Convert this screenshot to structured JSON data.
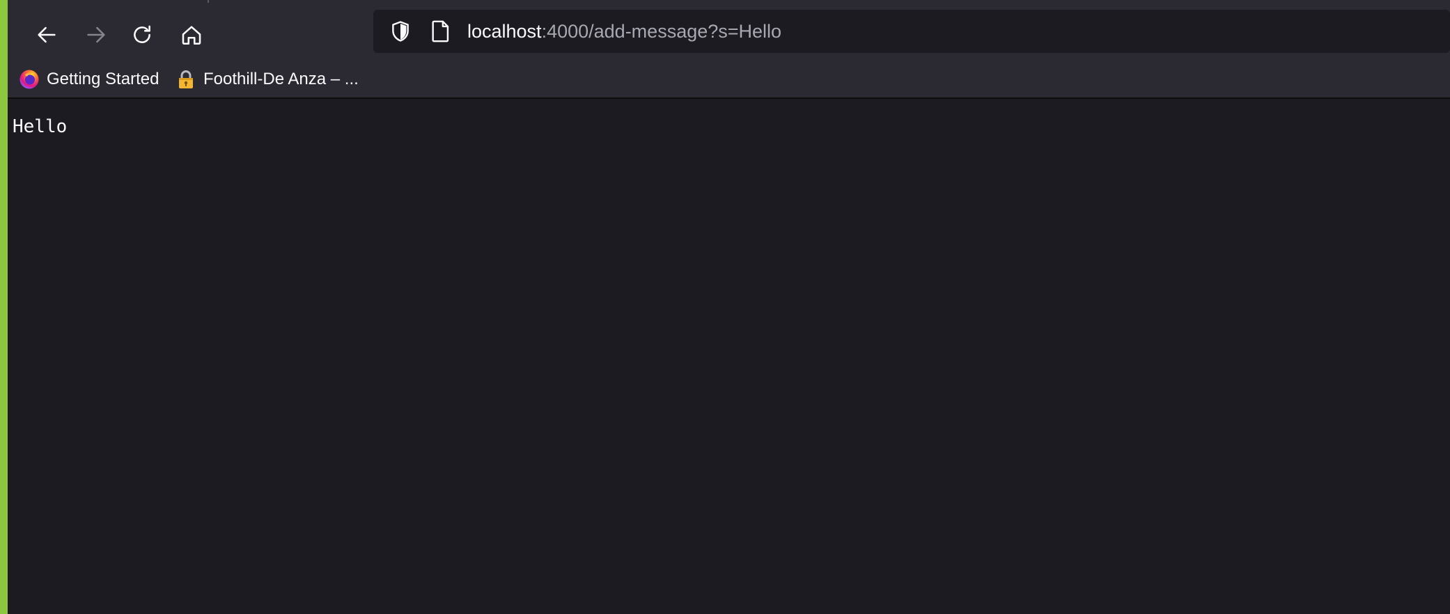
{
  "toolbar": {
    "back_icon": "back-arrow-icon",
    "forward_icon": "forward-arrow-icon",
    "reload_icon": "reload-icon",
    "home_icon": "home-icon"
  },
  "urlbar": {
    "host": "localhost",
    "rest": ":4000/add-message?s=Hello",
    "shield_icon": "tracking-protection-shield-icon",
    "page_icon": "page-icon"
  },
  "bookmarks": [
    {
      "label": "Getting Started",
      "icon": "firefox-logo-icon"
    },
    {
      "label": "Foothill-De Anza – ...",
      "icon": "lock-icon"
    }
  ],
  "page": {
    "text": "Hello"
  },
  "colors": {
    "accent_left_edge": "#8dc63f",
    "toolbar_bg": "#2b2a33",
    "content_bg": "#1c1b22",
    "text_primary": "#fbfbfe",
    "text_muted": "#a8a8b1"
  }
}
